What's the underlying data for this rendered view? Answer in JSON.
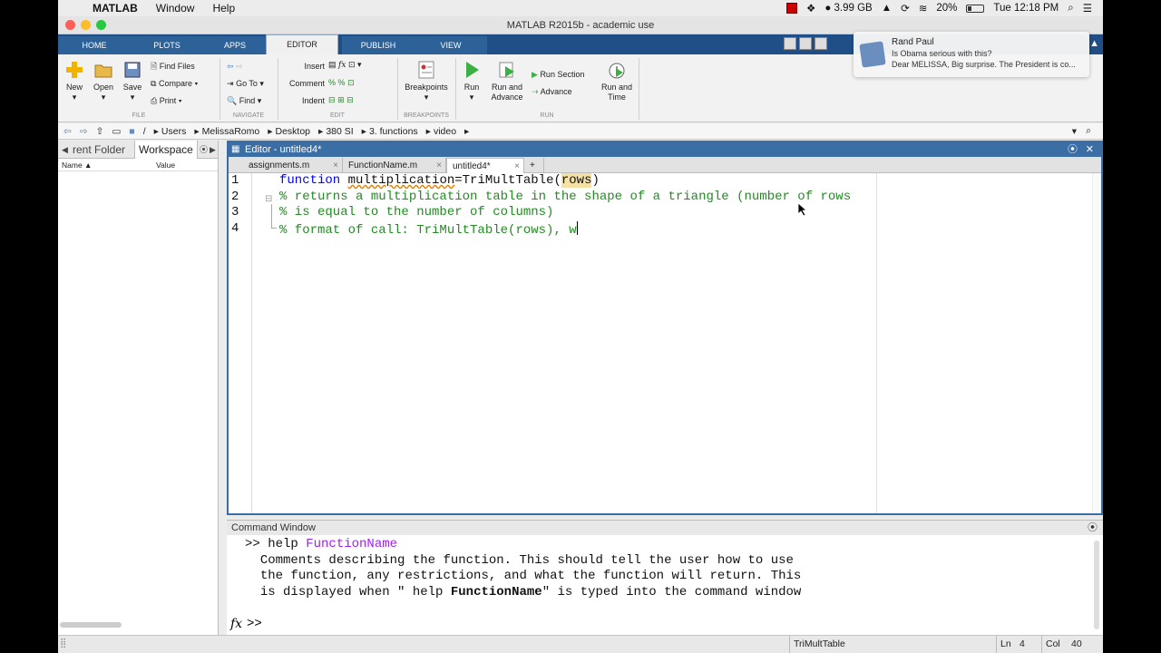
{
  "menubar": {
    "app": "MATLAB",
    "items": [
      "Window",
      "Help"
    ],
    "storage": "3.99 GB",
    "battery": "20%",
    "clock": "Tue 12:18 PM"
  },
  "window": {
    "title": "MATLAB R2015b - academic use"
  },
  "ribbon_tabs": [
    "HOME",
    "PLOTS",
    "APPS",
    "EDITOR",
    "PUBLISH",
    "VIEW"
  ],
  "ribbon": {
    "new": "New",
    "open": "Open",
    "save": "Save",
    "find_files": "Find Files",
    "compare": "Compare",
    "print": "Print",
    "goto": "Go To",
    "find": "Find",
    "insert": "Insert",
    "comment": "Comment",
    "indent": "Indent",
    "breakpoints": "Breakpoints",
    "run": "Run",
    "run_advance_1": "Run and",
    "run_advance_2": "Advance",
    "run_section": "Run Section",
    "advance": "Advance",
    "run_time_1": "Run and",
    "run_time_2": "Time",
    "sec_file": "FILE",
    "sec_navigate": "NAVIGATE",
    "sec_edit": "EDIT",
    "sec_breakpoints": "BREAKPOINTS",
    "sec_run": "RUN"
  },
  "address": [
    "/",
    "Users",
    "MelissaRomo",
    "Desktop",
    "380 SI",
    "3. functions",
    "video"
  ],
  "left_panel": {
    "tab1": "rent Folder",
    "tab2": "Workspace",
    "col_name": "Name ▲",
    "col_value": "Value"
  },
  "editor": {
    "title": "Editor - untitled4*",
    "tabs": [
      "assignments.m",
      "FunctionName.m",
      "untitled4*"
    ],
    "add_tab": "+",
    "line_numbers": [
      "1",
      "2",
      "3",
      "4"
    ],
    "line1": {
      "kw": "function ",
      "out": "multiplication",
      "eq": "=TriMultTable(",
      "arg": "rows",
      "close": ")"
    },
    "line2": "% returns a multiplication table in the shape of a triangle (number of rows",
    "line3": "% is equal to the number of columns)",
    "line4": "% format of call: TriMultTable(rows), w"
  },
  "command_window": {
    "title": "Command Window",
    "prompt": ">> help ",
    "cmd_arg": "FunctionName",
    "out1": "Comments describing the function. This should tell the user how to use",
    "out2": "the function, any restrictions, and what the function will return. This",
    "out3a": "is displayed when \" help ",
    "out3b": "FunctionName",
    "out3c": "\" is typed into the command window",
    "fx": "fx",
    "prompt2": ">>"
  },
  "statusbar": {
    "func": "TriMultTable",
    "ln_label": "Ln",
    "ln": "4",
    "col_label": "Col",
    "col": "40"
  },
  "notification": {
    "sender": "Rand Paul",
    "subject": "Is Obama serious with this?",
    "preview": "Dear MELISSA, Big surprise. The President is co..."
  }
}
